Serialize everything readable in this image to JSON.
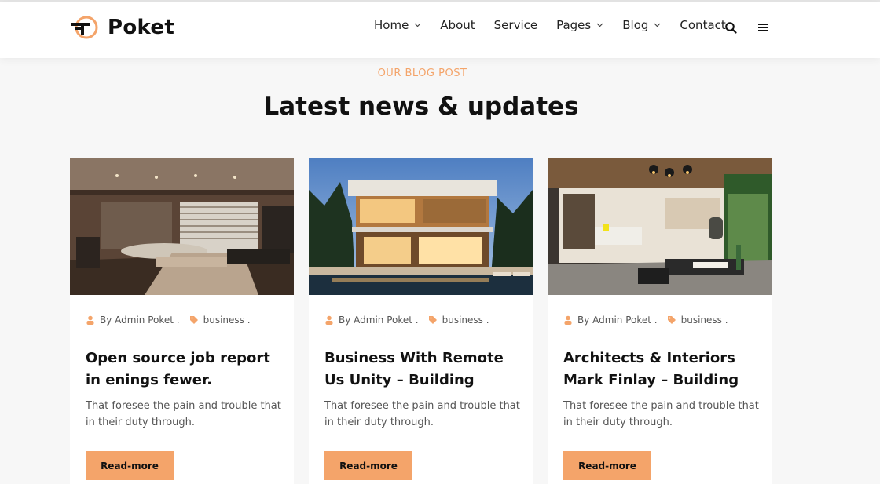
{
  "brand": {
    "name": "Poket",
    "accent": "#f4a46a"
  },
  "nav": {
    "items": [
      {
        "label": "Home",
        "dropdown": true
      },
      {
        "label": "About",
        "dropdown": false
      },
      {
        "label": "Service",
        "dropdown": false
      },
      {
        "label": "Pages",
        "dropdown": true
      },
      {
        "label": "Blog",
        "dropdown": true
      },
      {
        "label": "Contact",
        "dropdown": false
      }
    ],
    "search_icon": "search-icon",
    "menu_icon": "hamburger-icon"
  },
  "section": {
    "subtitle": "OUR BLOG POST",
    "title": "Latest news & updates"
  },
  "posts": [
    {
      "author": "By Admin Poket .",
      "category": "business .",
      "title": "Open source job report in enings fewer.",
      "excerpt": "That foresee the pain and trouble that in their duty through.",
      "button": "Read-more"
    },
    {
      "author": "By Admin Poket .",
      "category": "business .",
      "title": "Business With Remote Us Unity – Building",
      "excerpt": "That foresee the pain and trouble that in their duty through.",
      "button": "Read-more"
    },
    {
      "author": "By Admin Poket .",
      "category": "business .",
      "title": "Architects & Interiors Mark Finlay – Building",
      "excerpt": "That foresee the pain and trouble that in their duty through.",
      "button": "Read-more"
    }
  ]
}
